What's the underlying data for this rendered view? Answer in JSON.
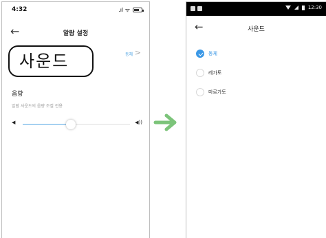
{
  "left_screen": {
    "status_time": "4:32",
    "status_signal": ".ıl ᯤ",
    "nav_title": "알람 설정",
    "sound_label": "사운드",
    "sound_value": "동체",
    "volume_title": "음량",
    "volume_desc": "알람 사운드의 음량 조절 전용",
    "volume_level": 0.45
  },
  "right_screen": {
    "status_time": "12:30",
    "nav_title": "사운드",
    "options": [
      {
        "label": "동체",
        "selected": true
      },
      {
        "label": "레가토",
        "selected": false
      },
      {
        "label": "마르가토",
        "selected": false
      }
    ]
  },
  "colors": {
    "accent": "#3b98e6",
    "arrow": "#7cc47a"
  }
}
